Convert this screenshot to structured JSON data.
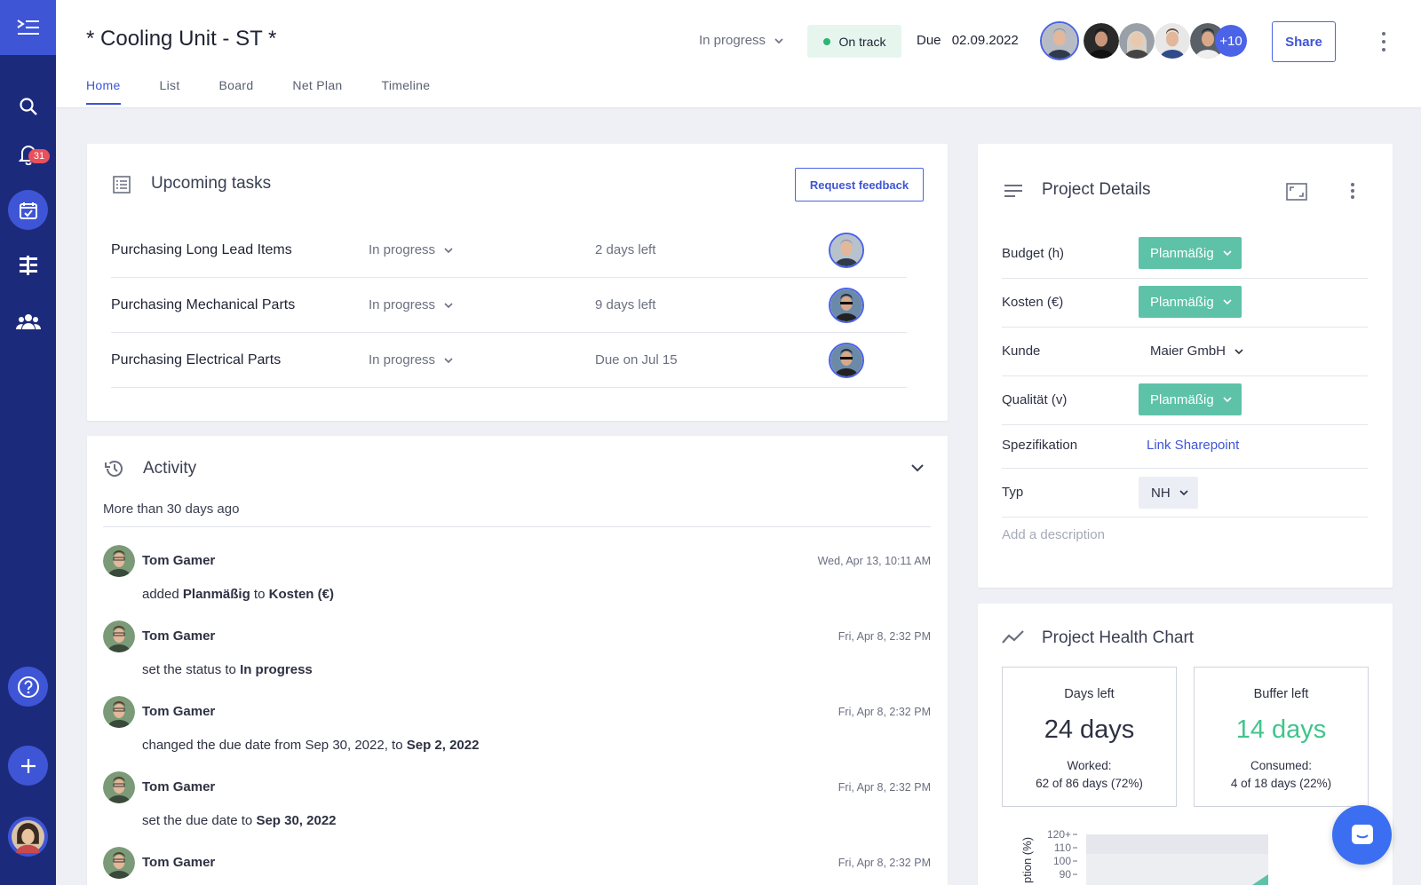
{
  "project": {
    "title": "* Cooling Unit - ST *",
    "status": "In progress",
    "health": "On track",
    "due_label": "Due",
    "due_date": "02.09.2022",
    "members_more": "+10",
    "share_label": "Share"
  },
  "sidebar": {
    "notification_count": "31"
  },
  "tabs": [
    "Home",
    "List",
    "Board",
    "Net Plan",
    "Timeline"
  ],
  "upcoming": {
    "title": "Upcoming tasks",
    "request_feedback_label": "Request feedback",
    "tasks": [
      {
        "name": "Purchasing Long Lead Items",
        "status": "In progress",
        "due": "2 days left"
      },
      {
        "name": "Purchasing Mechanical Parts",
        "status": "In progress",
        "due": "9 days left"
      },
      {
        "name": "Purchasing Electrical Parts",
        "status": "In progress",
        "due": "Due on Jul 15"
      }
    ]
  },
  "activity": {
    "title": "Activity",
    "section": "More than 30 days ago",
    "items": [
      {
        "user": "Tom Gamer",
        "time": "Wed, Apr 13, 10:11 AM",
        "pre": "added ",
        "b1": "Planmäßig",
        "mid": " to ",
        "b2": "Kosten (€)"
      },
      {
        "user": "Tom Gamer",
        "time": "Fri, Apr 8, 2:32 PM",
        "pre": "set the status to ",
        "b1": "In progress",
        "mid": "",
        "b2": ""
      },
      {
        "user": "Tom Gamer",
        "time": "Fri, Apr 8, 2:32 PM",
        "pre": "changed the due date from Sep 30, 2022, to ",
        "b1": "Sep 2, 2022",
        "mid": "",
        "b2": ""
      },
      {
        "user": "Tom Gamer",
        "time": "Fri, Apr 8, 2:32 PM",
        "pre": "set the due date to ",
        "b1": "Sep 30, 2022",
        "mid": "",
        "b2": ""
      },
      {
        "user": "Tom Gamer",
        "time": "Fri, Apr 8, 2:32 PM",
        "pre": "",
        "b1": "",
        "mid": "",
        "b2": ""
      }
    ]
  },
  "details": {
    "title": "Project Details",
    "budget_label": "Budget (h)",
    "budget_value": "Planmäßig",
    "kosten_label": "Kosten (€)",
    "kosten_value": "Planmäßig",
    "kunde_label": "Kunde",
    "kunde_value": "Maier GmbH",
    "qualitaet_label": "Qualität (v)",
    "qualitaet_value": "Planmäßig",
    "spezifikation_label": "Spezifikation",
    "spezifikation_value": "Link Sharepoint",
    "typ_label": "Typ",
    "typ_value": "NH",
    "description_placeholder": "Add a description"
  },
  "health": {
    "title": "Project Health Chart",
    "days_left_label": "Days left",
    "days_left_value": "24 days",
    "worked_label": "Worked:",
    "worked_value": "62 of 86 days (72%)",
    "buffer_left_label": "Buffer left",
    "buffer_left_value": "14 days",
    "consumed_label": "Consumed:",
    "consumed_value": "4 of 18 days (22%)",
    "chart_ylabel": "ption (%)",
    "chart_ticks": [
      "120+",
      "110",
      "100",
      "90"
    ]
  },
  "colors": {
    "sidebar": "#1c2a7c",
    "accent": "#3e55d6",
    "green_chip": "#5dc2a8",
    "on_track": "#2bb673"
  }
}
